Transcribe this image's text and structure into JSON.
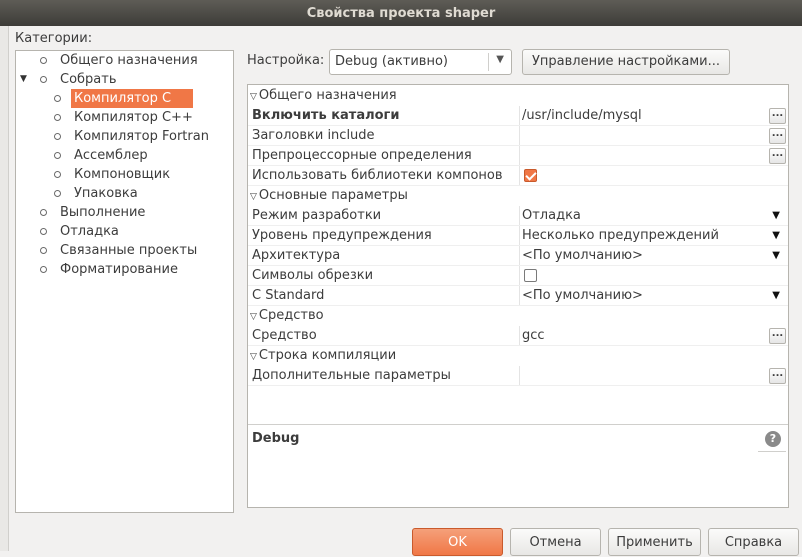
{
  "window": {
    "title": "Свойства проекта shaper"
  },
  "categories": {
    "label": "Категории:",
    "items": [
      {
        "label": "Общего назначения",
        "level": 0
      },
      {
        "label": "Собрать",
        "level": 0,
        "expanded": true
      },
      {
        "label": "Компилятор C",
        "level": 1,
        "selected": true
      },
      {
        "label": "Компилятор C++",
        "level": 1
      },
      {
        "label": "Компилятор Fortran",
        "level": 1
      },
      {
        "label": "Ассемблер",
        "level": 1
      },
      {
        "label": "Компоновщик",
        "level": 1
      },
      {
        "label": "Упаковка",
        "level": 1
      },
      {
        "label": "Выполнение",
        "level": 0
      },
      {
        "label": "Отладка",
        "level": 0
      },
      {
        "label": "Связанные проекты",
        "level": 0
      },
      {
        "label": "Форматирование",
        "level": 0
      }
    ]
  },
  "configuration": {
    "label": "Настройка:",
    "selected": "Debug (активно)",
    "manage_button": "Управление настройками..."
  },
  "properties": {
    "groups": [
      {
        "title": "Общего назначения",
        "rows": [
          {
            "name": "Включить каталоги",
            "value": "/usr/include/mysql",
            "control": "ellipsis",
            "bold": true
          },
          {
            "name": "Заголовки include",
            "value": "",
            "control": "ellipsis"
          },
          {
            "name": "Препроцессорные определения",
            "value": "",
            "control": "ellipsis"
          },
          {
            "name": "Использовать библиотеки компонов",
            "value": "",
            "control": "checkbox",
            "checked": true
          }
        ]
      },
      {
        "title": "Основные параметры",
        "rows": [
          {
            "name": "Режим разработки",
            "value": "Отладка",
            "control": "dropdown"
          },
          {
            "name": "Уровень предупреждения",
            "value": "Несколько предупреждений",
            "control": "dropdown"
          },
          {
            "name": "Архитектура",
            "value": "<По умолчанию>",
            "control": "dropdown"
          },
          {
            "name": "Символы обрезки",
            "value": "",
            "control": "checkbox",
            "checked": false
          },
          {
            "name": "C Standard",
            "value": "<По умолчанию>",
            "control": "dropdown"
          }
        ]
      },
      {
        "title": "Средство",
        "rows": [
          {
            "name": "Средство",
            "value": "gcc",
            "control": "ellipsis"
          }
        ]
      },
      {
        "title": "Строка компиляции",
        "rows": [
          {
            "name": "Дополнительные параметры",
            "value": "",
            "control": "ellipsis"
          }
        ]
      }
    ]
  },
  "description": {
    "title": "Debug",
    "help_icon": "question-icon"
  },
  "buttons": {
    "ok": "OK",
    "cancel": "Отмена",
    "apply": "Применить",
    "help": "Справка"
  },
  "colors": {
    "accent": "#f07746",
    "titlebar": "#3d3c38"
  }
}
